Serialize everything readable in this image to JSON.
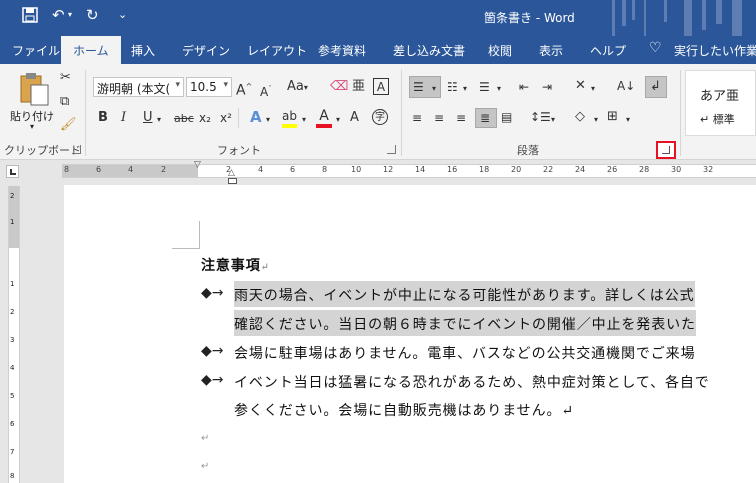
{
  "titlebar": {
    "doc_title": "箇条書き  -  Word",
    "save_icon": "save-icon",
    "undo_icon": "undo-icon",
    "redo_icon": "redo-icon",
    "customize_icon": "customize-quick-access-icon"
  },
  "tabs": [
    {
      "label": "ファイル"
    },
    {
      "label": "ホーム",
      "active": true
    },
    {
      "label": "挿入"
    },
    {
      "label": "デザイン"
    },
    {
      "label": "レイアウト"
    },
    {
      "label": "参考資料"
    },
    {
      "label": "差し込み文書"
    },
    {
      "label": "校閲"
    },
    {
      "label": "表示"
    },
    {
      "label": "ヘルプ"
    }
  ],
  "tellme": "実行したい作業を",
  "ribbon": {
    "clipboard": {
      "label": "クリップボード",
      "paste_label": "貼り付け"
    },
    "font": {
      "label": "フォント",
      "font_name": "游明朝 (本文(",
      "font_size": "10.5",
      "aa_label": "Aa",
      "bold": "B",
      "italic": "I",
      "underline": "U",
      "strike": "abc",
      "sub": "x₂",
      "sup": "x²"
    },
    "paragraph": {
      "label": "段落"
    },
    "styles": {
      "sample": "あア亜",
      "normal": "↵ 標準"
    }
  },
  "ruler": {
    "numbers": [
      "8",
      "6",
      "4",
      "2",
      "2",
      "4",
      "6",
      "8",
      "10",
      "12",
      "14",
      "16",
      "18",
      "20",
      "22",
      "24",
      "26",
      "28",
      "30",
      "32"
    ]
  },
  "vruler": {
    "numbers": [
      "2",
      "1",
      "1",
      "2",
      "3",
      "4",
      "5",
      "6",
      "7",
      "8"
    ]
  },
  "document": {
    "heading": "注意事項",
    "para_mark": "↵",
    "bullet_symbol": "◆→",
    "lines": [
      {
        "text": "雨天の場合、イベントが中止になる可能性があります。詳しくは公式",
        "bullet": true,
        "highlight": true
      },
      {
        "text": "確認ください。当日の朝６時までにイベントの開催／中止を発表いた",
        "bullet": false,
        "highlight": true
      },
      {
        "text": "会場に駐車場はありません。電車、バスなどの公共交通機関でご来場",
        "bullet": true,
        "highlight": false
      },
      {
        "text": "イベント当日は猛暑になる恐れがあるため、熱中症対策として、各自で",
        "bullet": true,
        "highlight": false
      },
      {
        "text": "参くください。会場に自動販売機はありません。↵",
        "bullet": false,
        "highlight": false
      }
    ]
  },
  "colors": {
    "titlebar": "#2b579a",
    "ribbon": "#f3f3f3",
    "highlight_box": "#e81123",
    "font_color_red": "#e81123",
    "highlighter_yellow": "#ffff00"
  }
}
